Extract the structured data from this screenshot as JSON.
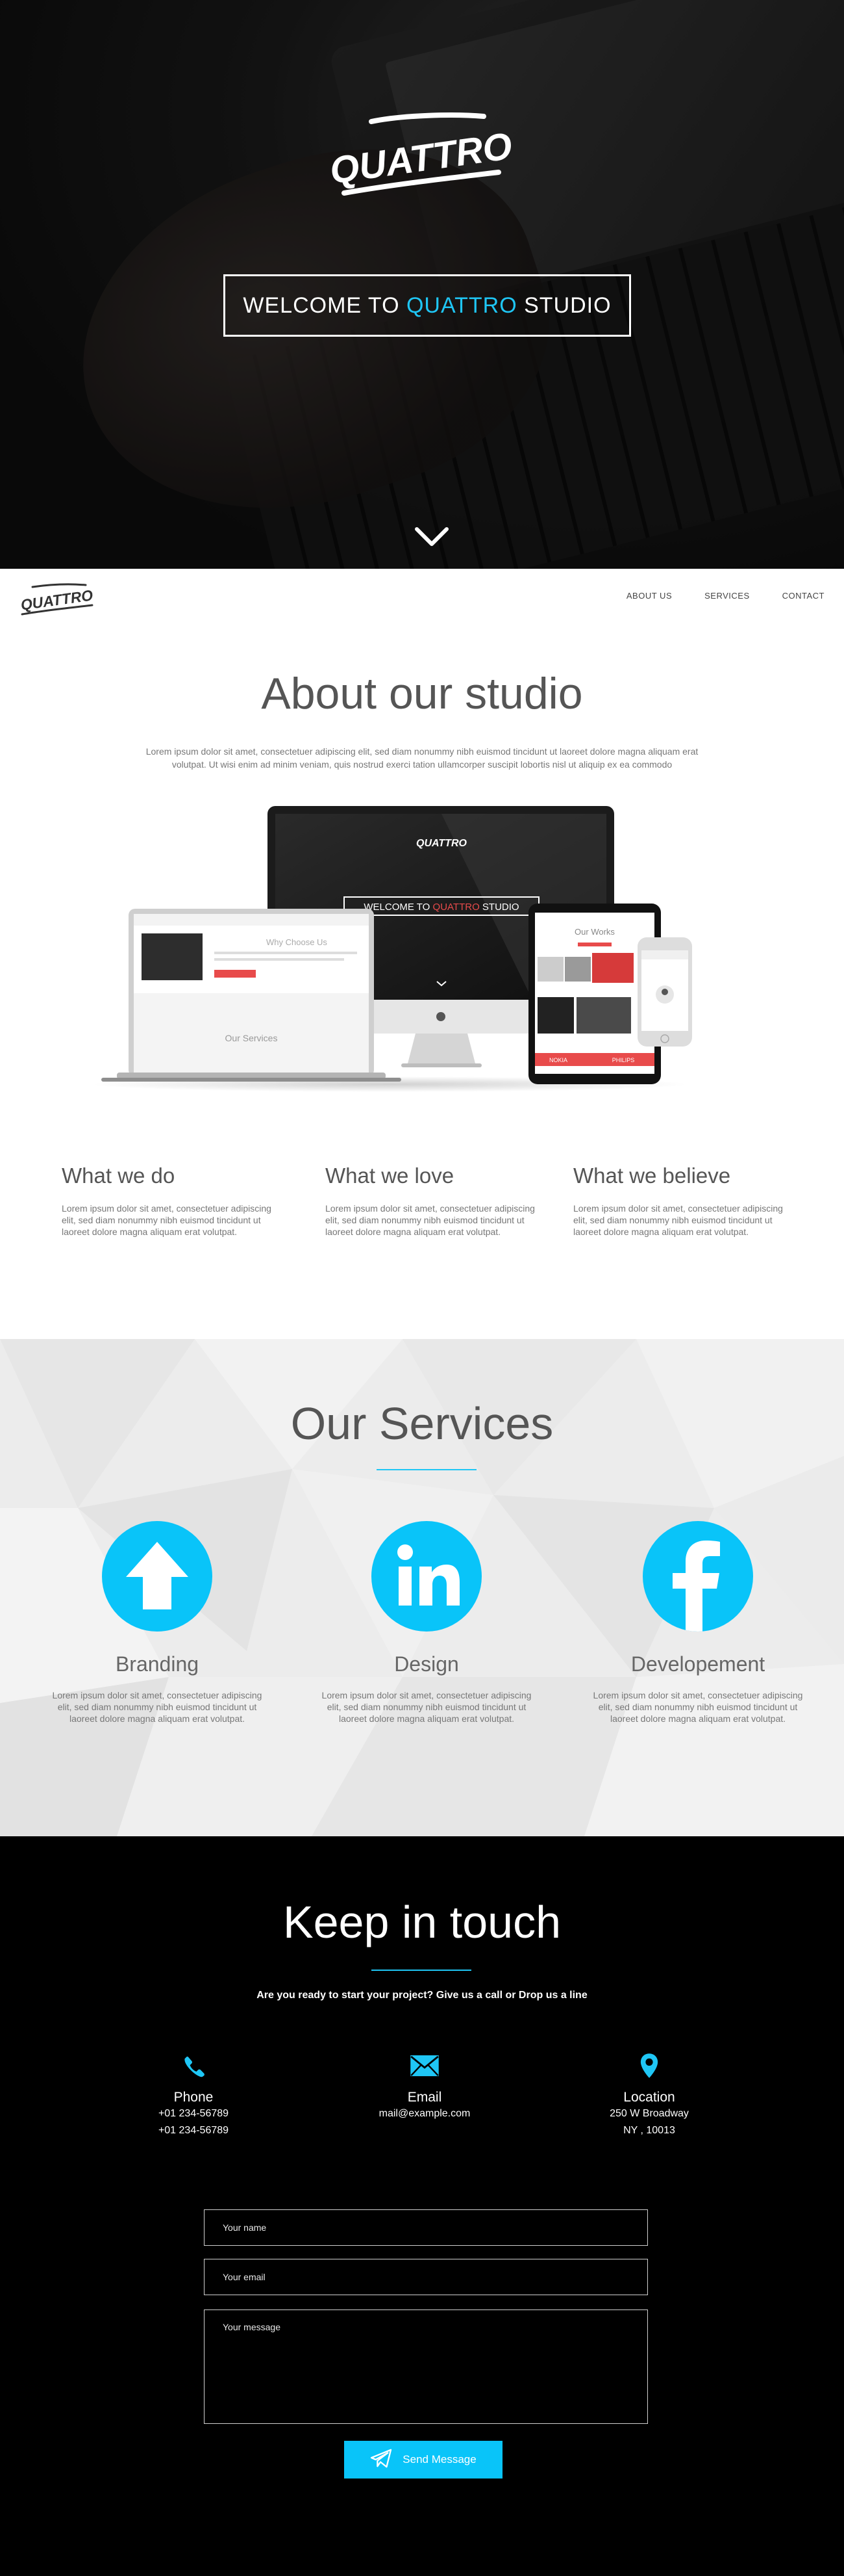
{
  "hero": {
    "logo_text": "QUATTRO",
    "welcome_prefix": "WELCOME TO ",
    "welcome_brand": "QUATTRO",
    "welcome_suffix": " STUDIO",
    "scroll_icon": "chevron-down-icon"
  },
  "nav": {
    "logo_text": "QUATTRO",
    "links": [
      "ABOUT US",
      "SERVICES",
      "CONTACT"
    ]
  },
  "about": {
    "title": "About our studio",
    "intro": "Lorem ipsum dolor sit amet, consectetuer adipiscing elit, sed diam nonummy nibh euismod tincidunt ut laoreet dolore magna aliquam erat volutpat. Ut wisi enim ad minim veniam, quis nostrud exerci tation ullamcorper suscipit lobortis nisl ut aliquip ex ea commodo",
    "mockup": {
      "imac_welcome_prefix": "WELCOME TO ",
      "imac_welcome_brand": "QUATTRO",
      "imac_welcome_suffix": " STUDIO",
      "laptop_heading": "Why Choose Us",
      "laptop_services": "Our Services",
      "tablet_heading": "Our Works",
      "tablet_label_left": "NOKIA",
      "tablet_label_right": "PHILIPS"
    },
    "columns": [
      {
        "title": "What we do",
        "text": "Lorem ipsum dolor sit amet, consectetuer adipiscing elit, sed diam nonummy nibh euismod tincidunt ut laoreet dolore magna aliquam erat volutpat."
      },
      {
        "title": "What we love",
        "text": "Lorem ipsum dolor sit amet, consectetuer adipiscing elit, sed diam nonummy nibh euismod tincidunt ut laoreet dolore magna aliquam erat volutpat."
      },
      {
        "title": "What we believe",
        "text": "Lorem ipsum dolor sit amet, consectetuer adipiscing elit, sed diam nonummy nibh euismod tincidunt ut laoreet dolore magna aliquam erat volutpat."
      }
    ]
  },
  "services": {
    "title": "Our Services",
    "items": [
      {
        "icon": "arrow-up-icon",
        "title": "Branding",
        "text": "Lorem ipsum dolor sit amet, consectetuer adipiscing elit, sed diam nonummy nibh euismod tincidunt ut laoreet dolore magna aliquam erat volutpat."
      },
      {
        "icon": "linkedin-icon",
        "title": "Design",
        "text": "Lorem ipsum dolor sit amet, consectetuer adipiscing elit, sed diam nonummy nibh euismod tincidunt ut laoreet dolore magna aliquam erat volutpat."
      },
      {
        "icon": "facebook-icon",
        "title": "Developement",
        "text": "Lorem ipsum dolor sit amet, consectetuer adipiscing elit, sed diam nonummy nibh euismod tincidunt ut laoreet dolore magna aliquam erat volutpat."
      }
    ]
  },
  "contact": {
    "title": "Keep in touch",
    "lead": "Are you ready to start your project? Give us a call or Drop us a line",
    "phone": {
      "icon": "phone-icon",
      "label": "Phone",
      "lines": [
        "+01 234-56789",
        "+01 234-56789"
      ]
    },
    "email": {
      "icon": "envelope-icon",
      "label": "Email",
      "lines": [
        "mail@example.com"
      ]
    },
    "location": {
      "icon": "map-pin-icon",
      "label": "Location",
      "lines": [
        "250 W Broadway",
        "NY , 10013"
      ]
    },
    "form": {
      "name_placeholder": "Your name",
      "email_placeholder": "Your email",
      "message_placeholder": "Your message",
      "send_label": "Send Message",
      "send_icon": "paper-plane-icon"
    }
  },
  "colors": {
    "accent": "#09c4f9",
    "hero_accent": "#1fc6f5",
    "mockup_accent": "#e84b4b"
  }
}
